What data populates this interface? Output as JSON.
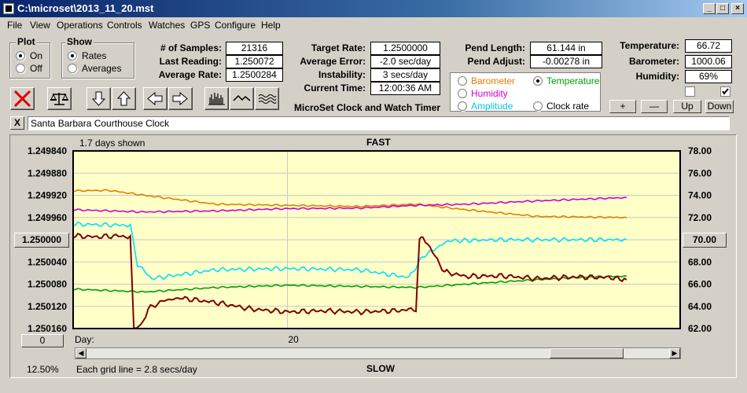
{
  "window": {
    "title": "C:\\microset\\2013_11_20.mst"
  },
  "menu": [
    "File",
    "View",
    "Operations",
    "Controls",
    "Watches",
    "GPS",
    "Configure",
    "Help"
  ],
  "plot_group": {
    "title": "Plot",
    "on": "On",
    "off": "Off",
    "selected": "On"
  },
  "show_group": {
    "title": "Show",
    "rates": "Rates",
    "averages": "Averages",
    "selected": "Rates"
  },
  "stats": {
    "samples_label": "# of Samples:",
    "samples": "21316",
    "last_label": "Last Reading:",
    "last": "1.250072",
    "avg_label": "Average Rate:",
    "avg": "1.2500284",
    "target_label": "Target Rate:",
    "target": "1.2500000",
    "avgerr_label": "Average Error:",
    "avgerr": "-2.0 sec/day",
    "instab_label": "Instability:",
    "instab": "3 secs/day",
    "time_label": "Current Time:",
    "time": "12:00:36 AM",
    "pendlen_label": "Pend Length:",
    "pendlen": "61.144 in",
    "pendadj_label": "Pend Adjust:",
    "pendadj": "-0.00278 in",
    "temp_label": "Temperature:",
    "temp": "66.72",
    "baro_label": "Barometer:",
    "baro": "1000.06",
    "hum_label": "Humidity:",
    "hum": "69%"
  },
  "app_title": "MicroSet Clock and Watch Timer",
  "aux_options": {
    "barometer": "Barometer",
    "temperature": "Temperature",
    "humidity": "Humidity",
    "amplitude": "Amplitude",
    "clockrate": "Clock rate",
    "selected": "Temperature"
  },
  "aux_buttons": {
    "plus": "+",
    "minus": "—",
    "up": "Up",
    "down": "Down"
  },
  "clock_name": "Santa Barbara Courthouse Clock",
  "close_x": "X",
  "chart_header": {
    "days_shown": "1.7 days shown",
    "fast": "FAST",
    "slow": "SLOW",
    "day_label": "Day:",
    "day_tick": "20",
    "grid_note": "Each grid line = 2.8 secs/day",
    "zoom": "12.50%",
    "left_button": "1.250000",
    "right_button": "70.00",
    "zero_button": "0"
  },
  "colors": {
    "plot_bg": "#ffffc8",
    "rate": "#800000",
    "temperature": "#00a000",
    "amplitude": "#00e0ff",
    "humidity": "#d000d0",
    "barometer": "#e08000"
  },
  "chart_data": {
    "type": "line",
    "title": "",
    "xlabel": "Day:",
    "ylabel_left": "",
    "ylabel_right": "",
    "x_range": [
      0,
      1.7
    ],
    "x_ticks": [
      {
        "value": 0.6,
        "label": "20"
      }
    ],
    "ylim_left": [
      1.24984,
      1.25016
    ],
    "ylim_right": [
      62.0,
      78.0
    ],
    "left_ticks": [
      "1.249840",
      "1.249880",
      "1.249920",
      "1.249960",
      "1.250000",
      "1.250040",
      "1.250080",
      "1.250120",
      "1.250160"
    ],
    "right_ticks": [
      "78.00",
      "76.00",
      "74.00",
      "72.00",
      "70.00",
      "68.00",
      "66.00",
      "64.00",
      "62.00"
    ],
    "series": [
      {
        "key": "rate",
        "axis": "left",
        "values": [
          [
            0.0,
            1.249993
          ],
          [
            0.06,
            1.249995
          ],
          [
            0.12,
            1.249993
          ],
          [
            0.16,
            1.249995
          ],
          [
            0.17,
            1.25016
          ],
          [
            0.19,
            1.250155
          ],
          [
            0.21,
            1.250125
          ],
          [
            0.25,
            1.25011
          ],
          [
            0.3,
            1.250105
          ],
          [
            0.4,
            1.250113
          ],
          [
            0.5,
            1.250125
          ],
          [
            0.6,
            1.25013
          ],
          [
            0.7,
            1.250128
          ],
          [
            0.8,
            1.25013
          ],
          [
            0.9,
            1.250128
          ],
          [
            0.96,
            1.250125
          ],
          [
            0.97,
            1.25
          ],
          [
            0.98,
            1.249995
          ],
          [
            1.0,
            1.250015
          ],
          [
            1.04,
            1.250058
          ],
          [
            1.1,
            1.250066
          ],
          [
            1.2,
            1.250065
          ],
          [
            1.3,
            1.25007
          ],
          [
            1.4,
            1.250067
          ],
          [
            1.5,
            1.250068
          ],
          [
            1.55,
            1.250072
          ]
        ]
      },
      {
        "key": "temperature",
        "axis": "right",
        "values": [
          [
            0.0,
            65.55
          ],
          [
            0.2,
            65.3
          ],
          [
            0.4,
            65.7
          ],
          [
            0.6,
            65.9
          ],
          [
            0.8,
            65.8
          ],
          [
            0.96,
            65.7
          ],
          [
            1.1,
            66.0
          ],
          [
            1.3,
            66.4
          ],
          [
            1.45,
            66.65
          ],
          [
            1.55,
            66.72
          ]
        ]
      },
      {
        "key": "amplitude",
        "axis": "right",
        "values": [
          [
            0.0,
            71.4
          ],
          [
            0.16,
            71.3
          ],
          [
            0.18,
            67.8
          ],
          [
            0.22,
            66.5
          ],
          [
            0.4,
            67.3
          ],
          [
            0.6,
            67.4
          ],
          [
            0.8,
            67.3
          ],
          [
            0.94,
            66.6
          ],
          [
            0.98,
            68.5
          ],
          [
            1.05,
            69.9
          ],
          [
            1.2,
            70.0
          ],
          [
            1.4,
            70.0
          ],
          [
            1.55,
            70.0
          ]
        ]
      },
      {
        "key": "humidity",
        "axis": "right",
        "values": [
          [
            0.0,
            72.7
          ],
          [
            0.2,
            72.5
          ],
          [
            0.4,
            72.6
          ],
          [
            0.6,
            72.8
          ],
          [
            0.8,
            72.85
          ],
          [
            0.96,
            73.1
          ],
          [
            1.1,
            73.2
          ],
          [
            1.3,
            73.5
          ],
          [
            1.55,
            73.8
          ]
        ]
      },
      {
        "key": "barometer",
        "axis": "right",
        "values": [
          [
            0.0,
            74.4
          ],
          [
            0.1,
            74.45
          ],
          [
            0.2,
            74.0
          ],
          [
            0.4,
            73.2
          ],
          [
            0.6,
            73.1
          ],
          [
            0.8,
            73.0
          ],
          [
            0.96,
            73.2
          ],
          [
            1.1,
            72.7
          ],
          [
            1.3,
            72.1
          ],
          [
            1.55,
            72.0
          ]
        ]
      }
    ],
    "grid": true
  }
}
